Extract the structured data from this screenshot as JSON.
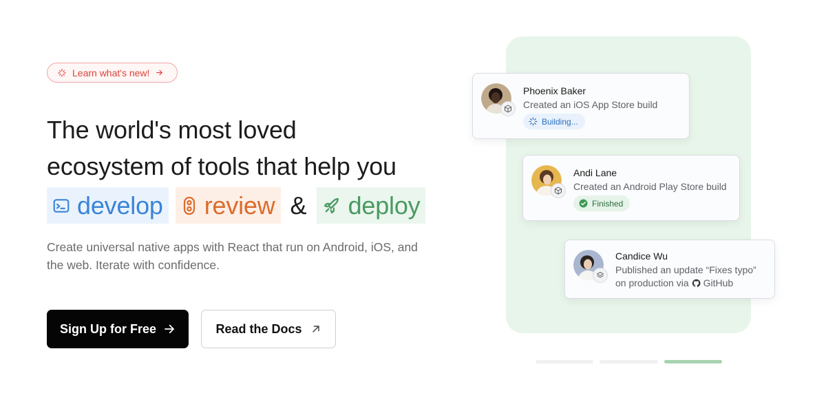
{
  "announcement": {
    "label": "Learn what's new!"
  },
  "hero": {
    "line1": "The world's most loved",
    "line2": "ecosystem of tools that help you",
    "tags": [
      {
        "label": "develop",
        "color": "#3a84d8"
      },
      {
        "label": "review",
        "color": "#dc6b2c"
      },
      {
        "label": "deploy",
        "color": "#4a9a62"
      }
    ],
    "ampersand": "&",
    "subtext": "Create universal native apps with React that run on Android, iOS, and the web. Iterate with confidence."
  },
  "actions": {
    "primary_label": "Sign Up for Free",
    "secondary_label": "Read the Docs"
  },
  "activity": [
    {
      "name": "Phoenix Baker",
      "description": "Created an iOS App Store build",
      "status": "Building..."
    },
    {
      "name": "Andi Lane",
      "description": "Created an Android Play Store build",
      "status": "Finished"
    },
    {
      "name": "Candice Wu",
      "description_line1": "Published an update “Fixes typo”",
      "description_line2_prefix": "on production via",
      "description_line2_link": "GitHub"
    }
  ],
  "carousel": {
    "slides": 3,
    "active_index": 2
  },
  "colors": {
    "accent_green": "#e8f5ea",
    "primary_button": "#050505",
    "pill_red": "#d8453a"
  }
}
